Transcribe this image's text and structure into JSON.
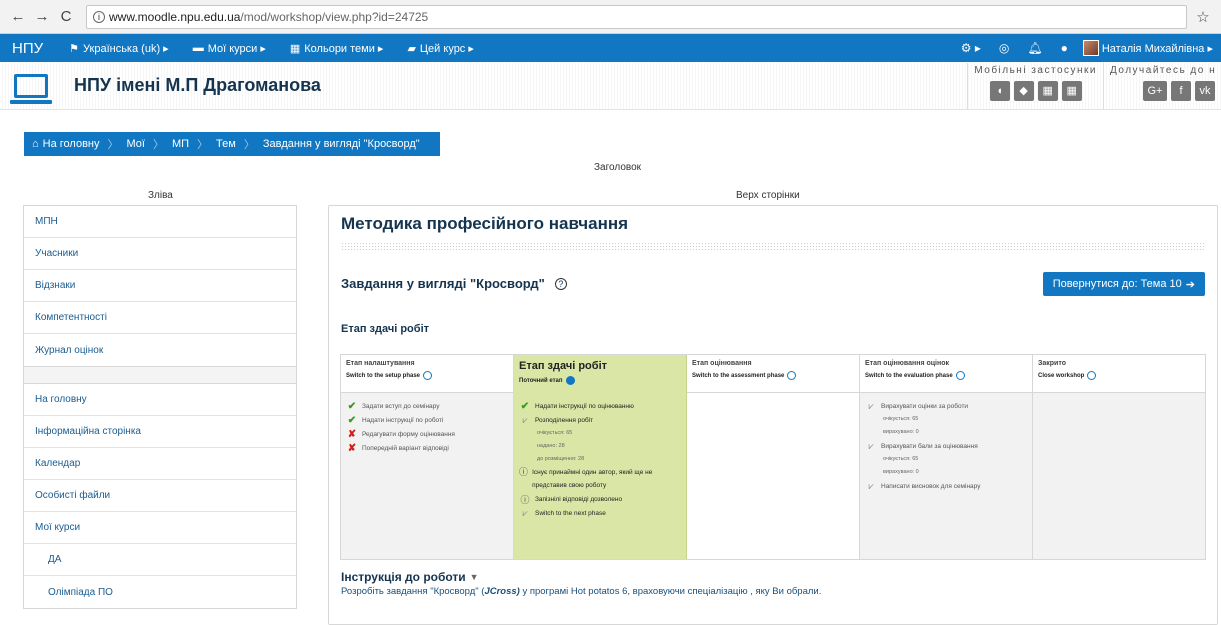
{
  "browser": {
    "url_host": "www.moodle.npu.edu.ua",
    "url_path": "/mod/workshop/view.php?id=24725"
  },
  "topbar": {
    "brand": "НПУ",
    "menu": [
      {
        "label": "Українська (uk) ▸"
      },
      {
        "label": "Мої курси ▸"
      },
      {
        "label": "Кольори теми ▸"
      },
      {
        "label": "Цей курс ▸"
      }
    ],
    "user_name": "Наталія Михайлівна ▸"
  },
  "header": {
    "site_title": "НПУ імені М.П Драгоманова",
    "mobile_label": "Мобільні застосунки",
    "join_label": "Долучайтесь до нас"
  },
  "breadcrumb": [
    "На головну",
    "Мої",
    "МП",
    "Тем",
    "Завдання у вигляді \"Кросворд\""
  ],
  "regions": {
    "top": "Заголовок",
    "left": "Зліва",
    "page_top": "Верх сторінки"
  },
  "sidebar": {
    "block1": [
      "МПН",
      "Учасники",
      "Відзнаки",
      "Компетентності",
      "Журнал оцінок"
    ],
    "block2": [
      {
        "label": "На головну",
        "sub": false
      },
      {
        "label": "Інформаційна сторінка",
        "sub": false
      },
      {
        "label": "Календар",
        "sub": false
      },
      {
        "label": "Особисті файли",
        "sub": false
      },
      {
        "label": "Мої курси",
        "sub": false
      },
      {
        "label": "ДА",
        "sub": true
      },
      {
        "label": "Олімпіада ПО",
        "sub": true
      }
    ]
  },
  "main": {
    "course_title": "Методика професійного навчання",
    "activity_title": "Завдання у вигляді \"Кросворд\"",
    "back_button": "Повернутися до: Тема 10",
    "current_phase_heading": "Етап здачі робіт",
    "phases": [
      {
        "name": "Етап налаштування",
        "switch": "Switch to the setup phase",
        "tasks": [
          {
            "status": "done",
            "text": "Задати вступ до семінару"
          },
          {
            "status": "done",
            "text": "Надати інструкції по роботі"
          },
          {
            "status": "fail",
            "text": "Редагувати форму оцінювання"
          },
          {
            "status": "fail",
            "text": "Попередній варіант відповіді"
          }
        ]
      },
      {
        "name": "Етап здачі робіт",
        "switch": "Поточний етап",
        "tasks": [
          {
            "status": "done",
            "text": "Надати інструкції по оцінюванню"
          },
          {
            "status": "todo",
            "text": "Розподілення робіт"
          },
          {
            "status": "sub",
            "text": "очікується: 65"
          },
          {
            "status": "sub",
            "text": "надано: 28"
          },
          {
            "status": "sub",
            "text": "до розміщення: 28"
          },
          {
            "status": "info",
            "text": "Існує принаймні один автор, який ще не представив свою роботу"
          },
          {
            "status": "info",
            "text": "Запізнілі відповіді дозволено"
          },
          {
            "status": "todo",
            "text": "Switch to the next phase"
          }
        ]
      },
      {
        "name": "Етап оцінювання",
        "switch": "Switch to the assessment phase",
        "tasks": []
      },
      {
        "name": "Етап оцінювання оцінок",
        "switch": "Switch to the evaluation phase",
        "tasks": [
          {
            "status": "todo",
            "text": "Вирахувати оцінки за роботи"
          },
          {
            "status": "sub",
            "text": "очікується: 65"
          },
          {
            "status": "sub",
            "text": "вирахувано: 0"
          },
          {
            "status": "todo",
            "text": "Вирахувати бали за оцінювання"
          },
          {
            "status": "sub",
            "text": "очікується: 65"
          },
          {
            "status": "sub",
            "text": "вирахувано: 0"
          },
          {
            "status": "todo",
            "text": "Написати висновок для семінару"
          }
        ]
      },
      {
        "name": "Закрито",
        "switch": "Close workshop",
        "tasks": []
      }
    ],
    "instructions_title": "Інструкція до роботи",
    "instructions_text_before": "Розробіть завдання \"Кросворд\" (",
    "instructions_text_em": "JCross)",
    "instructions_text_after": " у програмі Hot potatos 6, враховуючи спеціалізацію , яку Ви обрали."
  },
  "colors": {
    "brand_blue": "#1177c3",
    "active_phase": "#d9e6a6",
    "done": "#3a9b1a",
    "fail": "#d0201b"
  }
}
